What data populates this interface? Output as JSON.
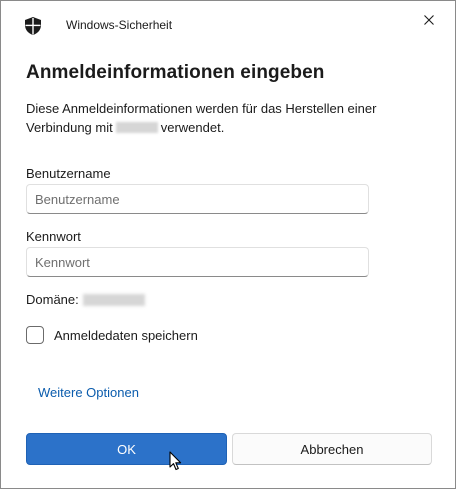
{
  "window": {
    "app_title": "Windows-Sicherheit",
    "icons": {
      "app": "shield-icon",
      "close": "close-icon"
    }
  },
  "dialog": {
    "heading": "Anmeldeinformationen eingeben",
    "description_part1": "Diese Anmeldeinformationen werden für das Herstellen einer Verbindung mit",
    "description_part2": "verwendet."
  },
  "form": {
    "username": {
      "label": "Benutzername",
      "placeholder": "Benutzername",
      "value": ""
    },
    "password": {
      "label": "Kennwort",
      "placeholder": "Kennwort",
      "value": ""
    },
    "domain_label": "Domäne:",
    "remember": {
      "label": "Anmeldedaten speichern",
      "checked": false
    }
  },
  "more_options": "Weitere Optionen",
  "buttons": {
    "ok": "OK",
    "cancel": "Abbrechen"
  },
  "colors": {
    "primary": "#2c72c9",
    "link": "#0b5cad",
    "text": "#1b1b1b"
  }
}
